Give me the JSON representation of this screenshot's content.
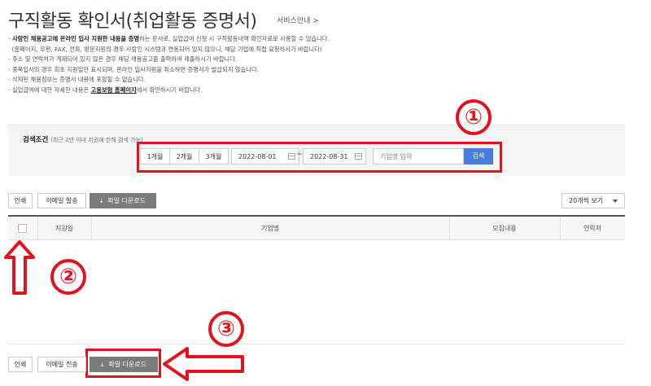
{
  "header": {
    "title": "구직활동 확인서(취업활동 증명서)",
    "service_link": "서비스안내 >"
  },
  "notes": {
    "line1_bold": "사람인 채용공고에 온라인 입사 지원한 내용을 증명",
    "line1_rest": "하는 문서로, 실업급여 신청 시 구직활동내역 확인자료로 사용할 수 있습니다.",
    "line2": "(홈페이지, 우편, FAX, 전화, 방문지원의 경우 사람인 시스템과 연동되어 있지 않으니, 해당 기업에 직접 요청하시기 바랍니다)",
    "line3": "주소 및 연락처가 게재되어 있지 않은 경우 해당 채용공고를 출력하여 제출하시기 바랍니다.",
    "line4": "중복입사의 경우 최초 지원일만 표시되며, 온라인 입사지원을 취소하면 증명서가 발급되지 않습니다.",
    "line5": "삭제된 채용정보는 증명서 내용에 포함될 수 없습니다.",
    "line6_pre": "실업급여에 대한 자세한 내용은",
    "line6_link": "고용보험 홈페이지",
    "line6_post": "에서 확인하시기 바랍니다."
  },
  "search": {
    "label": "검색조건",
    "note": "(최근 2년 이내 지원에 한해 검색 가능)",
    "period_1m": "1개월",
    "period_2m": "2개월",
    "period_3m": "3개월",
    "date_from": "2022-08-01",
    "tilde": "~",
    "date_to": "2022-08-31",
    "keyword_placeholder": "기업명 입력",
    "search_button": "검색"
  },
  "toolbar_top": {
    "print": "인쇄",
    "email": "이메일 발송",
    "download": "파일 다운로드",
    "per_page": "20개씩 보기"
  },
  "table": {
    "col_date": "지원일",
    "col_company": "기업명",
    "col_recruit": "모집내용",
    "col_contact": "연락처"
  },
  "toolbar_bottom": {
    "print": "인쇄",
    "email": "이메일 전송",
    "download": "파일 다운로드"
  },
  "annotations": {
    "step1": "①",
    "step2": "②",
    "step3": "③",
    "color": "#e0141e"
  },
  "colors": {
    "search_button": "#4a7bde",
    "download_button": "#7b7b7b"
  },
  "icons": {
    "download": "download-icon",
    "calendar": "calendar-icon",
    "dropdown": "chevron-down-icon",
    "service_arrow": "chevron-right-icon",
    "annotation_arrow": "arrow-icon"
  }
}
